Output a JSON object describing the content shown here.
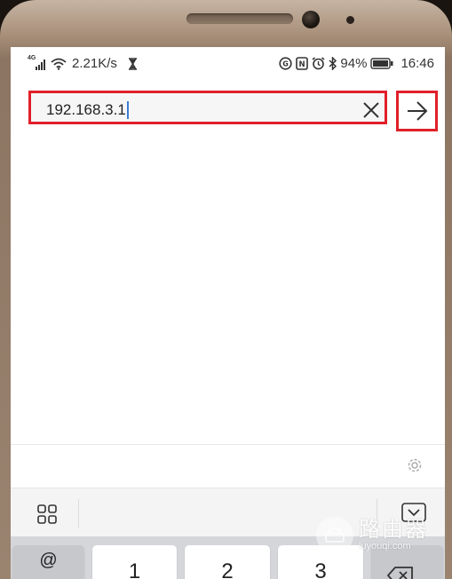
{
  "status_bar": {
    "network_type": "4G",
    "net_speed": "2.21K/s",
    "battery": "94%",
    "time": "16:46"
  },
  "browser": {
    "url_value": "192.168.3.1"
  },
  "keyboard": {
    "row1": [
      "@",
      "1",
      "2",
      "3"
    ]
  },
  "watermark": {
    "brand_cn": "路由器",
    "domain": "luyouqi.com"
  },
  "colors": {
    "highlight": "#e0202a",
    "caret": "#3a7bd5"
  }
}
